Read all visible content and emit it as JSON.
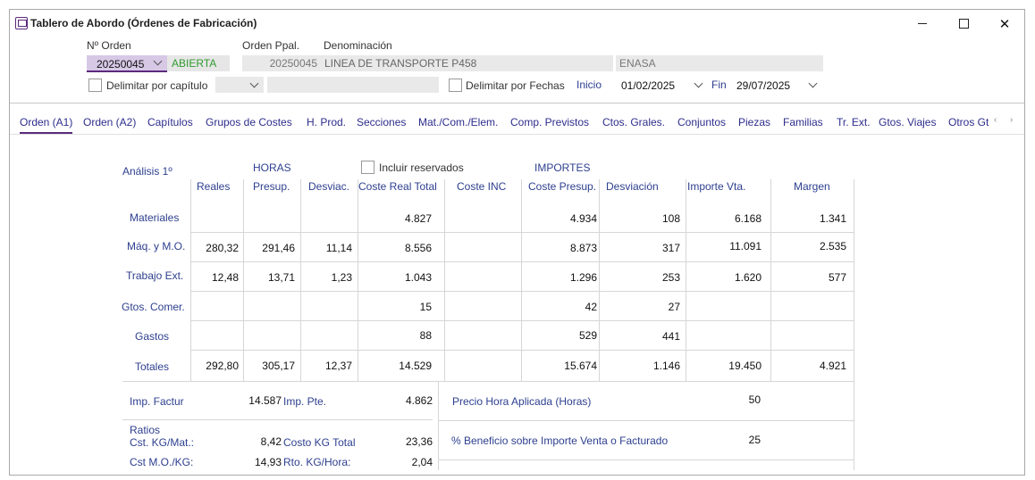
{
  "window": {
    "title": "Tablero de Abordo (Órdenes de Fabricación)"
  },
  "header": {
    "order_label": "Nº Orden",
    "order_value": "20250045",
    "order_status": "ABIERTA",
    "main_order_label": "Orden Ppal.",
    "denomination_label": "Denominación",
    "main_order_value": "20250045",
    "denomination_value": "LINEA DE TRANSPORTE P458",
    "client_value": "ENASA",
    "chapter_checkbox_label": "Delimitar por capítulo",
    "dates_checkbox_label": "Delimitar por Fechas",
    "start_label": "Inicio",
    "start_date": "01/02/2025",
    "end_label": "Fin",
    "end_date": "29/07/2025"
  },
  "tabs": [
    "Orden (A1)",
    "Orden (A2)",
    "Capítulos",
    "Grupos de Costes",
    "H. Prod.",
    "Secciones",
    "Mat./Com./Elem.",
    "Comp. Previstos",
    "Ctos. Grales.",
    "Conjuntos",
    "Piezas",
    "Familias",
    "Tr. Ext.",
    "Gtos. Viajes",
    "Otros Gt"
  ],
  "analysis": {
    "title": "Análisis 1º",
    "hours_group": "HORAS",
    "include_reserved_label": "Incluir reservados",
    "amounts_group": "IMPORTES",
    "columns": [
      "Reales",
      "Presup.",
      "Desviac.",
      "Coste Real Total",
      "Coste INC",
      "Coste Presup.",
      "Desviación",
      "Importe Vta.",
      "Margen"
    ],
    "rows": [
      {
        "label": "Materiales",
        "values": [
          "",
          "",
          "",
          "4.827",
          "",
          "4.934",
          "108",
          "6.168",
          "1.341"
        ]
      },
      {
        "label": "Máq. y M.O.",
        "values": [
          "280,32",
          "291,46",
          "11,14",
          "8.556",
          "",
          "8.873",
          "317",
          "11.091",
          "2.535"
        ]
      },
      {
        "label": "Trabajo Ext.",
        "values": [
          "12,48",
          "13,71",
          "1,23",
          "1.043",
          "",
          "1.296",
          "253",
          "1.620",
          "577"
        ]
      },
      {
        "label": "Gtos. Comer.",
        "values": [
          "",
          "",
          "",
          "15",
          "",
          "42",
          "27",
          "",
          ""
        ]
      },
      {
        "label": "Gastos",
        "values": [
          "",
          "",
          "",
          "88",
          "",
          "529",
          "441",
          "",
          ""
        ]
      },
      {
        "label": "Totales",
        "values": [
          "292,80",
          "305,17",
          "12,37",
          "14.529",
          "",
          "15.674",
          "1.146",
          "19.450",
          "4.921"
        ]
      }
    ]
  },
  "summary": {
    "imp_factur_label": "Imp. Factur",
    "imp_factur_value": "14.587",
    "imp_pte_label": "Imp. Pte.",
    "imp_pte_value": "4.862",
    "ratios_label": "Ratios",
    "cst_kg_mat_label": "Cst. KG/Mat.:",
    "cst_kg_mat_value": "8,42",
    "costo_kg_total_label": "Costo KG Total",
    "costo_kg_total_value": "23,36",
    "cst_mo_kg_label": "Cst M.O./KG:",
    "cst_mo_kg_value": "14,93",
    "rto_kg_hora_label": "Rto. KG/Hora:",
    "rto_kg_hora_value": "2,04",
    "precio_hora_label": "Precio Hora Aplicada (Horas)",
    "precio_hora_value": "50",
    "beneficio_label": "% Beneficio sobre Importe Venta o Facturado",
    "beneficio_value": "25"
  }
}
